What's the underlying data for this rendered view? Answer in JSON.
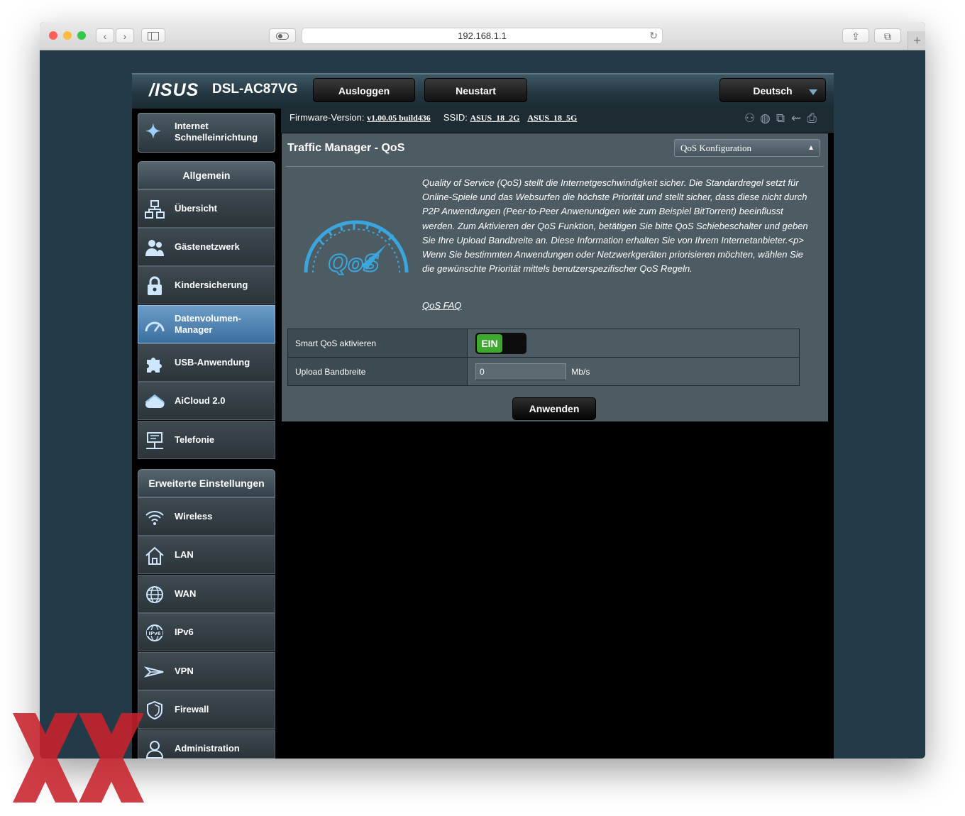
{
  "browser": {
    "url": "192.168.1.1",
    "colors": {
      "close": "#fc605b",
      "minimize": "#fdbc40",
      "zoom": "#34c84a"
    }
  },
  "header": {
    "brand": "/ISUS",
    "model": "DSL-AC87VG",
    "logout_label": "Ausloggen",
    "restart_label": "Neustart",
    "language": "Deutsch"
  },
  "infobar": {
    "firmware_label": "Firmware-Version:",
    "firmware_value": "v1.00.05 build436",
    "ssid_label": "SSID:",
    "ssid_2g": "ASUS_18_2G",
    "ssid_5g": "ASUS_18_5G",
    "status_icons": [
      "clients-icon",
      "internet-globe-icon",
      "devices-icon",
      "usb-icon",
      "printer-icon"
    ]
  },
  "sidebar": {
    "wizard_label_1": "Internet",
    "wizard_label_2": "Schnelleinrichtung",
    "general_title": "Allgemein",
    "general_items": [
      {
        "label": "Übersicht",
        "icon": "network-map-icon"
      },
      {
        "label": "Gästenetzwerk",
        "icon": "guest-network-icon"
      },
      {
        "label": "Kindersicherung",
        "icon": "parental-lock-icon"
      },
      {
        "label_1": "Datenvolumen-",
        "label_2": "Manager",
        "icon": "speedometer-icon",
        "active": true
      },
      {
        "label": "USB-Anwendung",
        "icon": "puzzle-icon"
      },
      {
        "label": "AiCloud 2.0",
        "icon": "cloud-icon"
      },
      {
        "label": "Telefonie",
        "icon": "telephony-icon"
      }
    ],
    "advanced_title": "Erweiterte Einstellungen",
    "advanced_items": [
      {
        "label": "Wireless",
        "icon": "wifi-icon"
      },
      {
        "label": "LAN",
        "icon": "home-icon"
      },
      {
        "label": "WAN",
        "icon": "globe-icon"
      },
      {
        "label": "IPv6",
        "icon": "ipv6-globe-icon"
      },
      {
        "label": "VPN",
        "icon": "vpn-icon"
      },
      {
        "label": "Firewall",
        "icon": "shield-icon"
      },
      {
        "label": "Administration",
        "icon": "admin-user-icon"
      }
    ]
  },
  "content": {
    "title": "Traffic Manager - QoS",
    "select_value": "QoS Konfiguration",
    "logo_text": "QoS",
    "description": "Quality of Service (QoS) stellt die Internetgeschwindigkeit sicher. Die Standardregel setzt für Online-Spiele und das Websurfen die höchste Priorität und stellt sicher, dass diese nicht durch P2P Anwendungen (Peer-to-Peer Anwenundgen wie zum Beispiel BitTorrent) beeinflusst werden. Zum Aktivieren der QoS Funktion, betätigen Sie bitte QoS Schiebeschalter und geben Sie Ihre Upload Bandbreite an. Diese Information erhalten Sie von Ihrem Internetanbieter.<p> Wenn Sie bestimmten Anwendungen oder Netzwerkgeräten priorisieren möchten, wählen Sie die gewünschte Priorität mittels benutzerspezifischer QoS Regeln.",
    "faq_link": "QoS FAQ",
    "smart_qos_label": "Smart QoS aktivieren",
    "smart_qos_state": "EIN",
    "upload_label": "Upload Bandbreite",
    "upload_value": "0",
    "upload_unit": "Mb/s",
    "apply_label": "Anwenden"
  },
  "colors": {
    "accent": "#3aa6dd",
    "toggle_on": "#3daa2f",
    "active_menu": "#4f86b8",
    "watermark": "#c8232c"
  }
}
